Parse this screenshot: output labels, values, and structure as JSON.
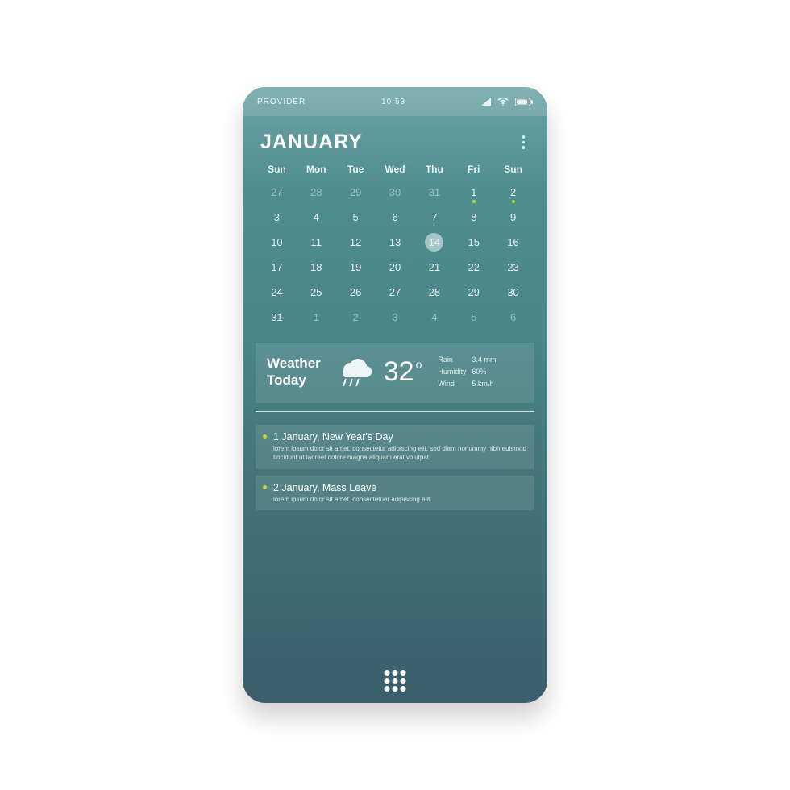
{
  "statusbar": {
    "provider": "PROVIDER",
    "time": "10:53"
  },
  "header": {
    "month": "JANUARY"
  },
  "calendar": {
    "weekdays": [
      "Sun",
      "Mon",
      "Tue",
      "Wed",
      "Thu",
      "Fri",
      "Sun"
    ],
    "rows": [
      [
        {
          "n": "27",
          "dim": true
        },
        {
          "n": "28",
          "dim": true
        },
        {
          "n": "29",
          "dim": true
        },
        {
          "n": "30",
          "dim": true
        },
        {
          "n": "31",
          "dim": true
        },
        {
          "n": "1",
          "dot": true
        },
        {
          "n": "2",
          "dot": true
        }
      ],
      [
        {
          "n": "3"
        },
        {
          "n": "4"
        },
        {
          "n": "5"
        },
        {
          "n": "6"
        },
        {
          "n": "7"
        },
        {
          "n": "8"
        },
        {
          "n": "9"
        }
      ],
      [
        {
          "n": "10"
        },
        {
          "n": "11"
        },
        {
          "n": "12"
        },
        {
          "n": "13"
        },
        {
          "n": "14",
          "selected": true
        },
        {
          "n": "15"
        },
        {
          "n": "16"
        }
      ],
      [
        {
          "n": "17"
        },
        {
          "n": "18"
        },
        {
          "n": "19"
        },
        {
          "n": "20"
        },
        {
          "n": "21"
        },
        {
          "n": "22"
        },
        {
          "n": "23"
        }
      ],
      [
        {
          "n": "24"
        },
        {
          "n": "25"
        },
        {
          "n": "26"
        },
        {
          "n": "27"
        },
        {
          "n": "28"
        },
        {
          "n": "29"
        },
        {
          "n": "30"
        }
      ],
      [
        {
          "n": "31"
        },
        {
          "n": "1",
          "dim": true
        },
        {
          "n": "2",
          "dim": true
        },
        {
          "n": "3",
          "dim": true
        },
        {
          "n": "4",
          "dim": true
        },
        {
          "n": "5",
          "dim": true
        },
        {
          "n": "6",
          "dim": true
        }
      ]
    ]
  },
  "weather": {
    "title1": "Weather",
    "title2": "Today",
    "temp": "32",
    "rain_lbl": "Rain",
    "rain_val": "3.4 mm",
    "hum_lbl": "Humidity",
    "hum_val": "60%",
    "wind_lbl": "Wind",
    "wind_val": "5 km/h"
  },
  "events": [
    {
      "title": "1 January, New Year's Day",
      "desc": "lorem ipsum dolor sit amet, consectetur adipiscing elit, sed diam nonummy nibh euismod tincidunt ut laoreet dolore magna aliquam erat volutpat."
    },
    {
      "title": "2 January, Mass Leave",
      "desc": "lorem ipsum dolor sit amet, consectetuer adipiscing elit."
    }
  ]
}
